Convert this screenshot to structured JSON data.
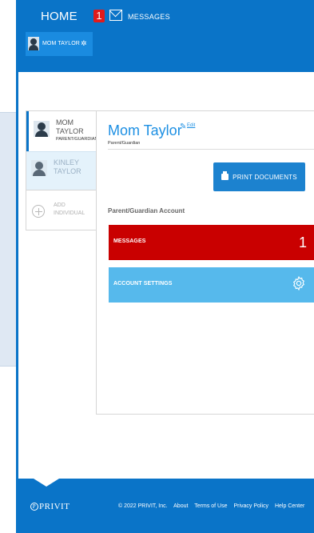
{
  "header": {
    "home_label": "HOME",
    "message_badge_count": "1",
    "messages_label": "MESSAGES",
    "user_tab_label": "MOM TAYLOR"
  },
  "people": [
    {
      "name_line1": "MOM",
      "name_line2": "TAYLOR",
      "role": "PARENT/GUARDIAN"
    },
    {
      "name_line1": "KINLEY",
      "name_line2": "TAYLOR"
    }
  ],
  "add_individual": {
    "line1": "ADD",
    "line2": "INDIVIDUAL"
  },
  "profile": {
    "name": "Mom Taylor",
    "edit_label": "Edit",
    "role": "Parent/Guardian",
    "print_button_label": "PRINT DOCUMENTS",
    "section_title": "Parent/Guardian Account"
  },
  "cards": {
    "messages_label": "MESSAGES",
    "messages_count": "1",
    "settings_label": "ACCOUNT SETTINGS"
  },
  "footer": {
    "logo_mark": "P",
    "logo_text": "PRIVIT",
    "copyright": "© 2022 PRIVIT, Inc.",
    "links": [
      "About",
      "Terms of Use",
      "Privacy Policy",
      "Help Center"
    ]
  },
  "colors": {
    "brand_blue": "#0a74c8",
    "name_blue": "#1c8fe3",
    "alert_red": "#c90000",
    "settings_blue": "#56b9ec"
  },
  "icons": [
    "mail-icon",
    "gear-icon",
    "avatar-icon",
    "plus-circle-icon",
    "edit-pencil-icon",
    "printer-icon",
    "settings-gear-icon"
  ]
}
